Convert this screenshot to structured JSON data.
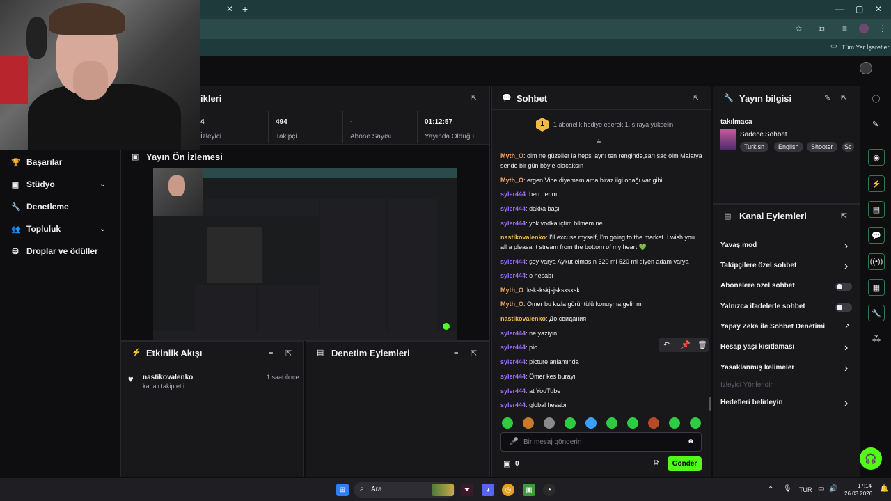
{
  "browser": {
    "bookmarks_label": "Tüm Yer İşaretleri"
  },
  "nav": {
    "items": [
      {
        "label": "Başarılar",
        "icon": "trophy-icon"
      },
      {
        "label": "Stüdyo",
        "icon": "video-icon"
      },
      {
        "label": "Denetleme",
        "icon": "wrench-icon"
      },
      {
        "label": "Topluluk",
        "icon": "people-icon"
      },
      {
        "label": "Droplar ve ödüller",
        "icon": "gift-icon"
      }
    ]
  },
  "stats": {
    "title": "ikleri",
    "items": [
      {
        "value": "4",
        "label": "İzleyici"
      },
      {
        "value": "494",
        "label": "Takipçi"
      },
      {
        "value": "-",
        "label": "Abone Sayısı"
      },
      {
        "value": "01:12:57",
        "label": "Yayında Olduğu"
      }
    ]
  },
  "preview": {
    "title": "Yayın Ön İzlemesi"
  },
  "activity": {
    "title": "Etkinlik Akışı",
    "item": {
      "user": "nastikovalenko",
      "text": "kanalı takip etti",
      "time": "1 saat önce"
    }
  },
  "moderation": {
    "title": "Denetim Eylemleri"
  },
  "chat": {
    "title": "Sohbet",
    "gift_badge": "1",
    "gift_text": "1 abonelik hediye ederek 1. sıraya yükselin",
    "messages": [
      {
        "user": "Myth_O",
        "cls": "u-myth",
        "text": "olm ne güzeller la hepsi aynı ten renginde,sarı saç olm Malatya sende bir gün böyle olacaksın"
      },
      {
        "user": "Myth_O",
        "cls": "u-myth",
        "text": "ergen Vibe diyemem ama biraz ilgi odağı var gibi"
      },
      {
        "user": "syler444",
        "cls": "u-syler",
        "text": "ben derim"
      },
      {
        "user": "syler444",
        "cls": "u-syler",
        "text": "dakka başı"
      },
      {
        "user": "syler444",
        "cls": "u-syler",
        "text": "yok vodka içtim bilmem ne"
      },
      {
        "user": "nastikovalenko",
        "cls": "u-nasti",
        "text": "I'll excuse myself, I'm going to the market. I wish you all a pleasant stream from the bottom of my heart 💚"
      },
      {
        "user": "syler444",
        "cls": "u-syler",
        "text": "şey varya Aykut elmasın 320 mi 520 mi diyen adam varya"
      },
      {
        "user": "syler444",
        "cls": "u-syler",
        "text": "o hesabı"
      },
      {
        "user": "Myth_O",
        "cls": "u-myth",
        "text": "kskskskjsjsksksksk"
      },
      {
        "user": "Myth_O",
        "cls": "u-myth",
        "text": "Ömer bu kızla görüntülü konuşma gelir mi"
      },
      {
        "user": "nastikovalenko",
        "cls": "u-nasti",
        "text": "До свидания"
      },
      {
        "user": "syler444",
        "cls": "u-syler",
        "text": "ne yaziyin"
      },
      {
        "user": "syler444",
        "cls": "u-syler",
        "text": "pic"
      },
      {
        "user": "syler444",
        "cls": "u-syler",
        "text": "picture anlamında"
      },
      {
        "user": "syler444",
        "cls": "u-syler",
        "text": "Ömer kes burayı"
      },
      {
        "user": "syler444",
        "cls": "u-syler",
        "text": "at YouTube"
      },
      {
        "user": "syler444",
        "cls": "u-syler",
        "text": "global hesabı"
      }
    ],
    "input_placeholder": "Bir mesaj gönderin",
    "points": "0",
    "send_label": "Gönder"
  },
  "stream_info": {
    "title": "Yayın bilgisi",
    "stream_title": "takılmaca",
    "category": "Sohbet",
    "category_prefix": "Sadece",
    "tags": [
      "Turkish",
      "English",
      "Shooter",
      "Sc"
    ]
  },
  "channel_actions": {
    "title": "Kanal Eylemleri",
    "rows": [
      {
        "label": "Yavaş mod",
        "kind": "chevron"
      },
      {
        "label": "Takipçilere özel sohbet",
        "kind": "chevron"
      },
      {
        "label": "Abonelere özel sohbet",
        "kind": "toggle"
      },
      {
        "label": "Yalnızca ifadelerle sohbet",
        "kind": "toggle"
      },
      {
        "label": "Yapay Zeka ile Sohbet Denetimi",
        "kind": "external"
      },
      {
        "label": "Hesap yaşı kısıtlaması",
        "kind": "chevron"
      },
      {
        "label": "Yasaklanmış kelimeler",
        "kind": "chevron"
      },
      {
        "label": "İzleyici Yönlendir",
        "kind": "disabled"
      },
      {
        "label": "Hedefleri belirleyin",
        "kind": "chevron"
      }
    ]
  },
  "taskbar": {
    "search": "Ara",
    "lang": "TUR",
    "time": "17:14",
    "date": "26.03.2026"
  },
  "colors": {
    "accent": "#53fc18",
    "purple": "#9a6bff",
    "panel": "#18181b"
  }
}
